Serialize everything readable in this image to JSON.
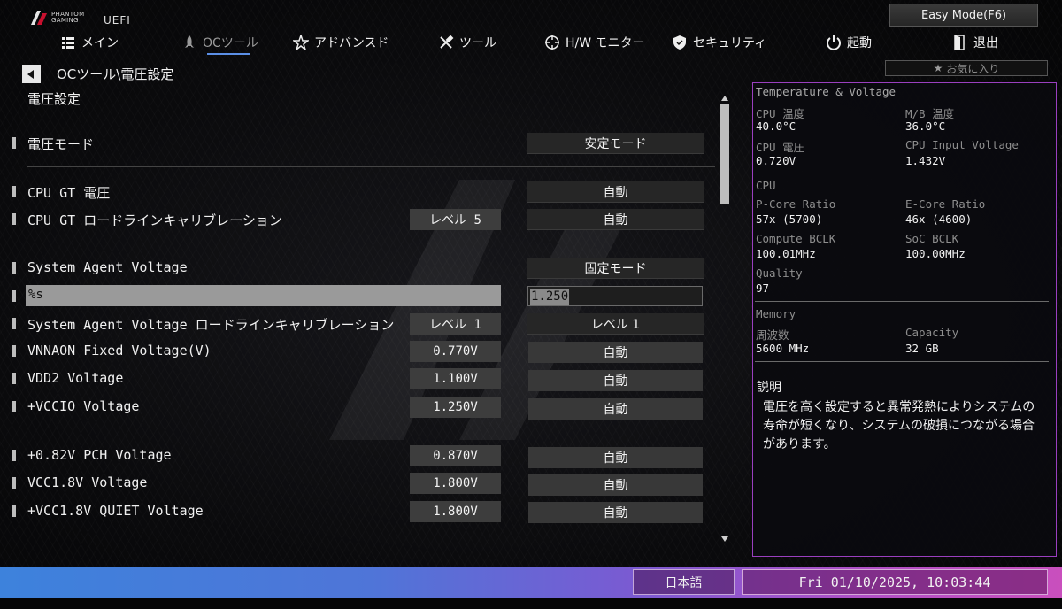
{
  "header": {
    "brand_line1": "PHANTOM",
    "brand_line2": "GAMING",
    "uefi_label": "UEFI",
    "easy_mode_label": "Easy Mode(F6)"
  },
  "nav": [
    {
      "label": "メイン",
      "icon": "list-icon"
    },
    {
      "label": "OCツール",
      "icon": "rocket-icon",
      "active": true
    },
    {
      "label": "アドバンスド",
      "icon": "star-icon"
    },
    {
      "label": "ツール",
      "icon": "tools-icon"
    },
    {
      "label": "H/W モニター",
      "icon": "crosshair-icon"
    },
    {
      "label": "セキュリティ",
      "icon": "shield-icon"
    },
    {
      "label": "起動",
      "icon": "power-icon"
    },
    {
      "label": "退出",
      "icon": "exit-icon"
    }
  ],
  "breadcrumb": "OCツール\\電圧設定",
  "section_title": "電圧設定",
  "settings": {
    "voltage_mode": {
      "label": "電圧モード",
      "value": "安定モード"
    },
    "cpu_gt_voltage": {
      "label": "CPU GT 電圧",
      "value": "自動"
    },
    "cpu_gt_llc": {
      "label": "CPU GT ロードラインキャリブレーション",
      "current": "レベル 5",
      "value": "自動"
    },
    "sa_voltage": {
      "label": "System Agent Voltage",
      "value": "固定モード"
    },
    "sa_fixed": {
      "label": "%s",
      "value": "1.250"
    },
    "sa_llc": {
      "label": "System Agent Voltage ロードラインキャリブレーション",
      "current": "レベル 1",
      "value": "レベル 1"
    },
    "vnnaon": {
      "label": "VNNAON Fixed Voltage(V)",
      "current": "0.770V",
      "value": "自動"
    },
    "vdd2": {
      "label": "VDD2 Voltage",
      "current": "1.100V",
      "value": "自動"
    },
    "vccio": {
      "label": "+VCCIO Voltage",
      "current": "1.250V",
      "value": "自動"
    },
    "pch": {
      "label": "+0.82V PCH Voltage",
      "current": "0.870V",
      "value": "自動"
    },
    "vcc18": {
      "label": "VCC1.8V Voltage",
      "current": "1.800V",
      "value": "自動"
    },
    "vcc18quiet": {
      "label": "+VCC1.8V QUIET Voltage",
      "current": "1.800V",
      "value": "自動"
    }
  },
  "favorites_label": "お気に入り",
  "hw_panel": {
    "title": "Temperature & Voltage",
    "cpu_temp_label": "CPU 温度",
    "cpu_temp": "40.0°C",
    "mb_temp_label": "M/B 温度",
    "mb_temp": "36.0°C",
    "cpu_voltage_label": "CPU 電圧",
    "cpu_voltage": "0.720V",
    "cpu_input_label": "CPU Input Voltage",
    "cpu_input": "1.432V",
    "cpu_title": "CPU",
    "pcore_label": "P-Core Ratio",
    "pcore": "57x (5700)",
    "ecore_label": "E-Core Ratio",
    "ecore": "46x (4600)",
    "compute_bclk_label": "Compute BCLK",
    "compute_bclk": "100.01MHz",
    "soc_bclk_label": "SoC BCLK",
    "soc_bclk": "100.00MHz",
    "quality_label": "Quality",
    "quality": "97",
    "memory_title": "Memory",
    "freq_label": "周波数",
    "freq": "5600 MHz",
    "capacity_label": "Capacity",
    "capacity": "32 GB"
  },
  "description": {
    "title": "説明",
    "body": "電圧を高く設定すると異常発熱によりシステムの寿命が短くなり、システムの破損につながる場合があります。"
  },
  "footer": {
    "language": "日本語",
    "datetime": "Fri 01/10/2025, 10:03:44"
  },
  "colors": {
    "panel_border": "#9a3fbf",
    "nav_underline": "#5b8fe6",
    "footer_start": "#3d82dc",
    "footer_end": "#c94fbd"
  }
}
